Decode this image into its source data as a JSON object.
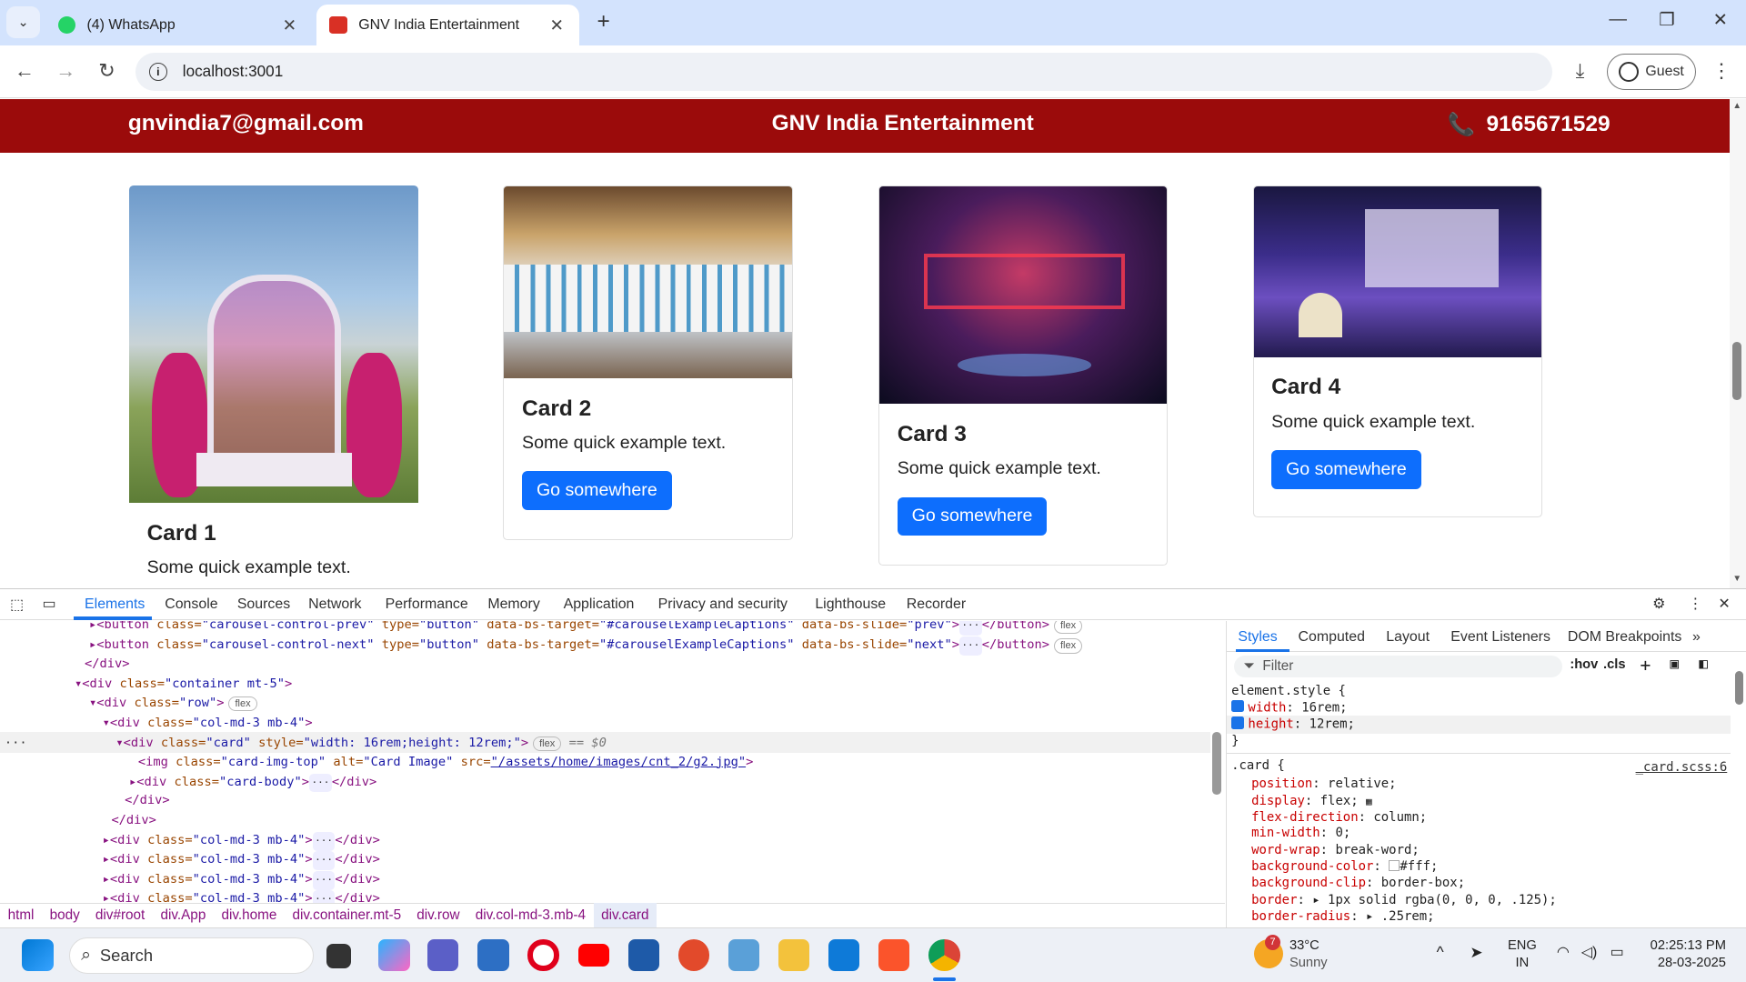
{
  "browser": {
    "tabs": [
      {
        "title": "(4) WhatsApp",
        "active": false
      },
      {
        "title": "GNV India Entertainment",
        "active": true
      }
    ],
    "url": "localhost:3001",
    "profile": "Guest"
  },
  "site": {
    "header": {
      "email": "gnvindia7@gmail.com",
      "brand": "GNV India Entertainment",
      "phone": "9165671529"
    },
    "cards": [
      {
        "title": "Card 1",
        "text": "Some quick example text.",
        "button": null
      },
      {
        "title": "Card 2",
        "text": "Some quick example text.",
        "button": "Go somewhere"
      },
      {
        "title": "Card 3",
        "text": "Some quick example text.",
        "button": "Go somewhere"
      },
      {
        "title": "Card 4",
        "text": "Some quick example text.",
        "button": "Go somewhere"
      }
    ]
  },
  "devtools": {
    "tabs": [
      "Elements",
      "Console",
      "Sources",
      "Network",
      "Performance",
      "Memory",
      "Application",
      "Privacy and security",
      "Lighthouse",
      "Recorder"
    ],
    "active_tab": "Elements",
    "dom_lines": {
      "l1": {
        "tag": "<button ",
        "a1": "class=",
        "v1": "\"carousel-control-prev\"",
        "a2": " type=",
        "v2": "\"button\"",
        "a3": " data-bs-target=",
        "v3": "\"#carouselExampleCaptions\"",
        "a4": " data-bs-slide=",
        "v4": "\"prev\"",
        "end": "</button>",
        "pill": "flex"
      },
      "l2": {
        "tag": "<button ",
        "a1": "class=",
        "v1": "\"carousel-control-next\"",
        "a2": " type=",
        "v2": "\"button\"",
        "a3": " data-bs-target=",
        "v3": "\"#carouselExampleCaptions\"",
        "a4": " data-bs-slide=",
        "v4": "\"next\"",
        "end": "</button>",
        "pill": "flex"
      },
      "l3": "</div>",
      "l4": {
        "tag": "<div ",
        "a1": "class=",
        "v1": "\"container mt-5\"",
        "end": ">"
      },
      "l5": {
        "tag": "<div ",
        "a1": "class=",
        "v1": "\"row\"",
        "end": ">",
        "pill": "flex"
      },
      "l6": {
        "tag": "<div ",
        "a1": "class=",
        "v1": "\"col-md-3 mb-4\"",
        "end": ">"
      },
      "l7": {
        "tag": "<div ",
        "a1": "class=",
        "v1": "\"card\"",
        "a2": " style=",
        "v2": "\"width: 16rem;height: 12rem;\"",
        "end": ">",
        "pill": "flex",
        "marker": "== $0"
      },
      "l8": {
        "tag": "<img ",
        "a1": "class=",
        "v1": "\"card-img-top\"",
        "a2": " alt=",
        "v2": "\"Card Image\"",
        "a3": " src=",
        "v3": "\"/assets/home/images/cnt_2/g2.jpg\"",
        "end": ">"
      },
      "l9": {
        "tag": "<div ",
        "a1": "class=",
        "v1": "\"card-body\"",
        "end": "</div>"
      },
      "l10": "</div>",
      "l11": "</div>",
      "l12": {
        "tag": "<div ",
        "a1": "class=",
        "v1": "\"col-md-3 mb-4\"",
        "end": "</div>"
      },
      "l13": {
        "tag": "<div ",
        "a1": "class=",
        "v1": "\"col-md-3 mb-4\"",
        "end": "</div>"
      },
      "l14": {
        "tag": "<div ",
        "a1": "class=",
        "v1": "\"col-md-3 mb-4\"",
        "end": "</div>"
      },
      "l15": {
        "tag": "<div ",
        "a1": "class=",
        "v1": "\"col-md-3 mb-4\"",
        "end": "</div>"
      }
    },
    "breadcrumbs": [
      "html",
      "body",
      "div#root",
      "div.App",
      "div.home",
      "div.container.mt-5",
      "div.row",
      "div.col-md-3.mb-4",
      "div.card"
    ],
    "styles_tabs": [
      "Styles",
      "Computed",
      "Layout",
      "Event Listeners",
      "DOM Breakpoints"
    ],
    "filter_placeholder": "Filter",
    "hov": ":hov",
    "cls": ".cls",
    "element_style": {
      "selector": "element.style {",
      "rules": [
        {
          "p": "width",
          "v": "16rem;"
        },
        {
          "p": "height",
          "v": "12rem;"
        }
      ],
      "close": "}"
    },
    "card_rule": {
      "selector": ".card {",
      "source": "_card.scss:6",
      "rules": [
        {
          "p": "position",
          "v": "relative;"
        },
        {
          "p": "display",
          "v": "flex;"
        },
        {
          "p": "flex-direction",
          "v": "column;"
        },
        {
          "p": "min-width",
          "v": "0;"
        },
        {
          "p": "word-wrap",
          "v": "break-word;"
        },
        {
          "p": "background-color",
          "v": "#fff;"
        },
        {
          "p": "background-clip",
          "v": "border-box;"
        },
        {
          "p": "border",
          "v": "1px solid rgba(0, 0, 0, .125);"
        },
        {
          "p": "border-radius",
          "v": ".25rem;"
        }
      ]
    }
  },
  "taskbar": {
    "search": "Search",
    "weather": {
      "temp": "33°C",
      "cond": "Sunny",
      "badge": "7"
    },
    "lang": {
      "l1": "ENG",
      "l2": "IN"
    },
    "time": "02:25:13 PM",
    "date": "28-03-2025"
  },
  "colors": {
    "header_bg": "#9b0b0b",
    "button": "#0d6efd",
    "devtools_accent": "#1a73e8"
  }
}
